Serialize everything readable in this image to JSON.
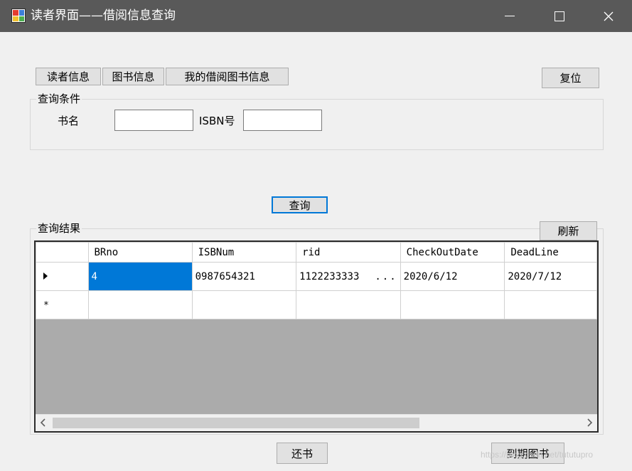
{
  "window": {
    "title": "读者界面——借阅信息查询",
    "titlebar_color": "#595959",
    "minimize_icon": "minimize-icon",
    "maximize_icon": "maximize-icon",
    "close_icon": "close-icon"
  },
  "nav": {
    "reader_info": "读者信息",
    "book_info": "图书信息",
    "my_borrow_info": "我的借阅图书信息",
    "reset": "复位"
  },
  "query": {
    "group_title": "查询条件",
    "book_name_label": "书名",
    "book_name_value": "",
    "isbn_label": "ISBN号",
    "isbn_value": "",
    "query_button": "查询"
  },
  "results": {
    "group_title": "查询结果",
    "refresh_button": "刷新",
    "columns": [
      "BRno",
      "ISBNum",
      "rid",
      "CheckOutDate",
      "DeadLine"
    ],
    "rows": [
      [
        "4",
        "0987654321",
        "1122233333",
        "2020/6/12",
        "2020/7/12"
      ]
    ],
    "truncation_marker": "...",
    "selection_color": "#0078d7"
  },
  "footer": {
    "return_button": "还书",
    "due_books_button": "到期图书",
    "watermark": "https://blog.csdn.net/tututupro"
  }
}
